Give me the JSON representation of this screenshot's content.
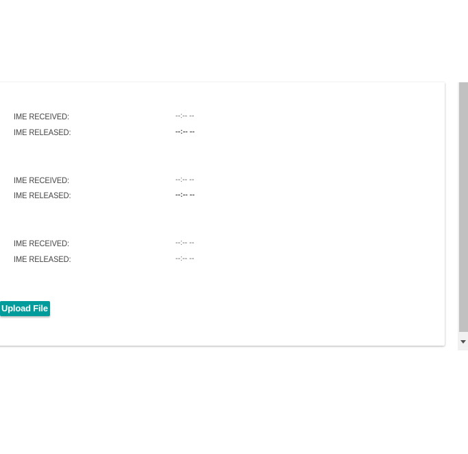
{
  "sections": [
    {
      "received_label": "IME RECEIVED:",
      "received_value": "--:-- --",
      "released_label": "IME RELEASED:",
      "released_value": "--:-- --"
    },
    {
      "received_label": "IME RECEIVED:",
      "received_value": "--:-- --",
      "released_label": "IME RELEASED:",
      "released_value": "--:-- --"
    },
    {
      "received_label": "IME RECEIVED:",
      "received_value": "--:-- --",
      "released_label": "IME RELEASED:",
      "released_value": "--:-- --"
    }
  ],
  "actions": {
    "upload_label": "Upload File"
  },
  "colors": {
    "accent": "#009b9b",
    "scroll_thumb": "#c1c1c1"
  },
  "icons": {
    "scroll_down": "triangle-down-icon"
  }
}
